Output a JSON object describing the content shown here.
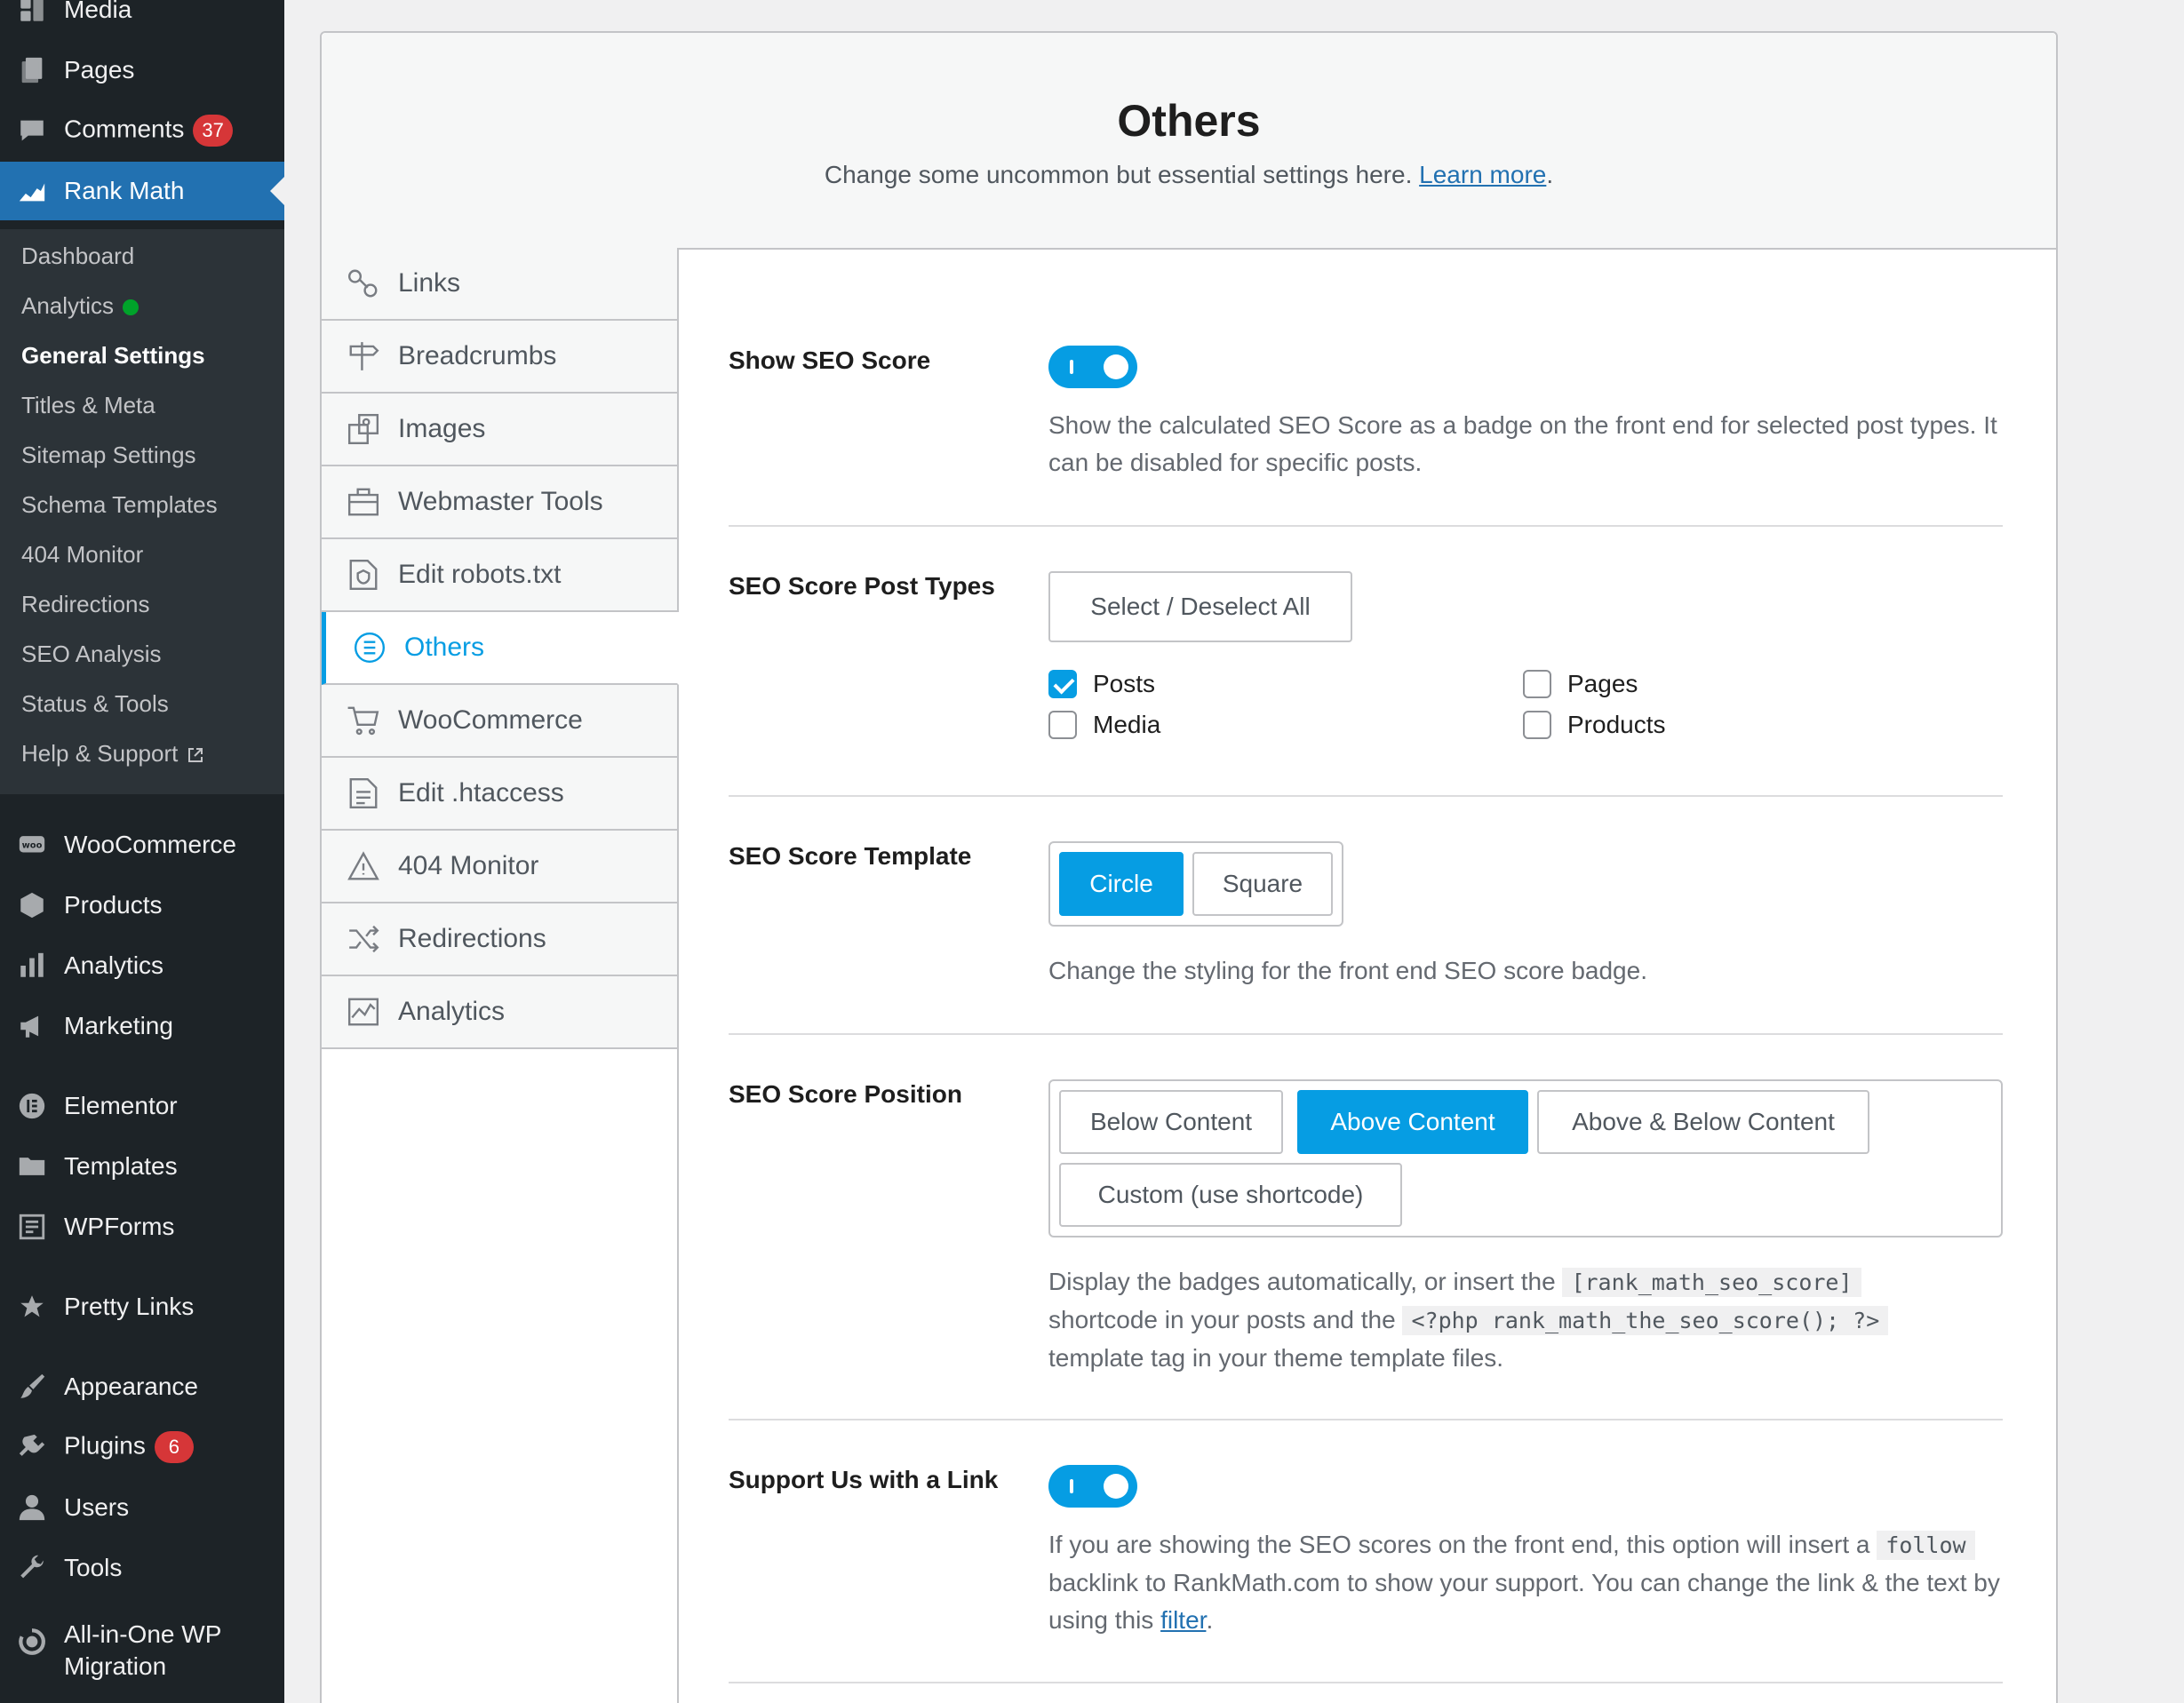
{
  "sidebar": {
    "items": [
      {
        "label": "Media",
        "icon": "media-icon"
      },
      {
        "label": "Pages",
        "icon": "pages-icon"
      },
      {
        "label": "Comments",
        "icon": "comments-icon",
        "badge": "37"
      },
      {
        "label": "Rank Math",
        "icon": "rank-math-icon"
      },
      {
        "label": "WooCommerce",
        "icon": "woocommerce-icon"
      },
      {
        "label": "Products",
        "icon": "products-icon"
      },
      {
        "label": "Analytics",
        "icon": "analytics-bar-icon"
      },
      {
        "label": "Marketing",
        "icon": "megaphone-icon"
      },
      {
        "label": "Elementor",
        "icon": "elementor-icon"
      },
      {
        "label": "Templates",
        "icon": "folder-icon"
      },
      {
        "label": "WPForms",
        "icon": "wpforms-icon"
      },
      {
        "label": "Pretty Links",
        "icon": "star-icon"
      },
      {
        "label": "Appearance",
        "icon": "brush-icon"
      },
      {
        "label": "Plugins",
        "icon": "plugin-icon",
        "badge": "6"
      },
      {
        "label": "Users",
        "icon": "user-icon"
      },
      {
        "label": "Tools",
        "icon": "wrench-icon"
      },
      {
        "label_line1": "All-in-One WP",
        "label_line2": "Migration",
        "icon": "migration-icon"
      }
    ],
    "submenu": [
      "Dashboard",
      "Analytics",
      "General Settings",
      "Titles & Meta",
      "Sitemap Settings",
      "Schema Templates",
      "404 Monitor",
      "Redirections",
      "SEO Analysis",
      "Status & Tools",
      "Help & Support"
    ]
  },
  "header": {
    "title": "Others",
    "description": "Change some uncommon but essential settings here.",
    "learn_more": "Learn more",
    "period": "."
  },
  "tabs": [
    {
      "label": "Links",
      "icon": "link-icon"
    },
    {
      "label": "Breadcrumbs",
      "icon": "signpost-icon"
    },
    {
      "label": "Images",
      "icon": "images-icon"
    },
    {
      "label": "Webmaster Tools",
      "icon": "toolbox-icon"
    },
    {
      "label": "Edit robots.txt",
      "icon": "robots-file-icon"
    },
    {
      "label": "Others",
      "icon": "list-circle-icon",
      "active": true
    },
    {
      "label": "WooCommerce",
      "icon": "cart-icon"
    },
    {
      "label": "Edit .htaccess",
      "icon": "file-text-icon"
    },
    {
      "label": "404 Monitor",
      "icon": "warning-icon"
    },
    {
      "label": "Redirections",
      "icon": "shuffle-icon"
    },
    {
      "label": "Analytics",
      "icon": "chart-line-icon"
    }
  ],
  "settings": {
    "show_score": {
      "title": "Show SEO Score",
      "enabled": true,
      "desc": "Show the calculated SEO Score as a badge on the front end for selected post types. It can be disabled for specific posts."
    },
    "post_types": {
      "title": "SEO Score Post Types",
      "select_all": "Select / Deselect All",
      "options": [
        {
          "label": "Posts",
          "checked": true
        },
        {
          "label": "Pages",
          "checked": false
        },
        {
          "label": "Media",
          "checked": false
        },
        {
          "label": "Products",
          "checked": false
        }
      ]
    },
    "template": {
      "title": "SEO Score Template",
      "options": [
        "Circle",
        "Square"
      ],
      "selected": "Circle",
      "desc": "Change the styling for the front end SEO score badge."
    },
    "position": {
      "title": "SEO Score Position",
      "options": [
        "Below Content",
        "Above Content",
        "Above & Below Content",
        "Custom (use shortcode)"
      ],
      "selected": "Above Content",
      "desc_1": "Display the badges automatically, or insert the",
      "code_1": "[rank_math_seo_score]",
      "desc_2": "shortcode in your posts and the",
      "code_2": "<?php rank_math_the_seo_score(); ?>",
      "desc_3": "template tag in your theme template files."
    },
    "support": {
      "title": "Support Us with a Link",
      "enabled": true,
      "desc_1": "If you are showing the SEO scores on the front end, this option will insert a",
      "code": "follow",
      "desc_2": "backlink to RankMath.com to show your support. You can change the link & the text by using this",
      "link": "filter",
      "period": "."
    }
  },
  "colors": {
    "accent": "#069de3",
    "wp_blue": "#2271b1",
    "sidebar_bg": "#1d2327",
    "badge_red": "#d63638"
  }
}
